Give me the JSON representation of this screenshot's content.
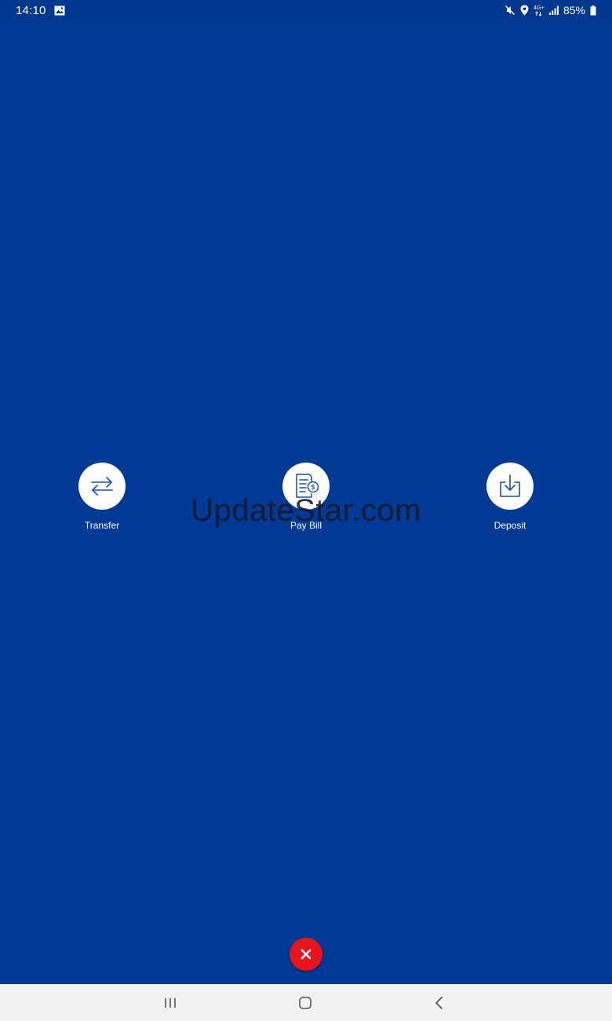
{
  "status_bar": {
    "time": "14:10",
    "network": "4G+",
    "battery": "85%",
    "icons": [
      "gallery-icon",
      "mute-icon",
      "location-icon",
      "network-4g-icon",
      "signal-icon",
      "battery-icon"
    ]
  },
  "actions": [
    {
      "label": "Transfer",
      "icon": "transfer-icon"
    },
    {
      "label": "Pay Bill",
      "icon": "pay-bill-icon"
    },
    {
      "label": "Deposit",
      "icon": "deposit-icon"
    }
  ],
  "watermark": "UpdateStar.com",
  "fab": {
    "icon": "close-icon",
    "color": "#e8161c"
  },
  "nav_bar": {
    "icons": [
      "recent-apps-icon",
      "home-icon",
      "back-icon"
    ]
  },
  "colors": {
    "background": "#003a96",
    "status_bar": "#00388f",
    "icon_blue": "#1d4fa3",
    "nav_bar": "#f2f2f2"
  }
}
